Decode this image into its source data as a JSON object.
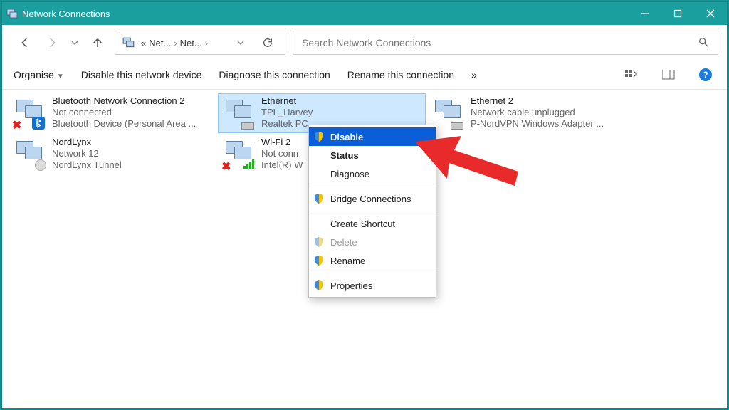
{
  "window": {
    "title": "Network Connections"
  },
  "nav": {
    "crumb_prefix": "«",
    "crumb1": "Net...",
    "crumb2": "Net...",
    "search_placeholder": "Search Network Connections"
  },
  "cmdbar": {
    "organise": "Organise",
    "disable_device": "Disable this network device",
    "diagnose": "Diagnose this connection",
    "rename": "Rename this connection",
    "overflow": "»"
  },
  "connections": [
    {
      "name": "Bluetooth Network Connection 2",
      "status": "Not connected",
      "device": "Bluetooth Device (Personal Area ..."
    },
    {
      "name": "Ethernet",
      "status": "TPL_Harvey",
      "device": "Realtek PC"
    },
    {
      "name": "Ethernet 2",
      "status": "Network cable unplugged",
      "device": "P-NordVPN Windows Adapter ..."
    },
    {
      "name": "NordLynx",
      "status": "Network 12",
      "device": "NordLynx Tunnel"
    },
    {
      "name": "Wi-Fi 2",
      "status": "Not conn",
      "device": "Intel(R) W"
    }
  ],
  "ctx": {
    "disable": "Disable",
    "status": "Status",
    "diagnose": "Diagnose",
    "bridge": "Bridge Connections",
    "shortcut": "Create Shortcut",
    "delete": "Delete",
    "rename": "Rename",
    "properties": "Properties"
  }
}
